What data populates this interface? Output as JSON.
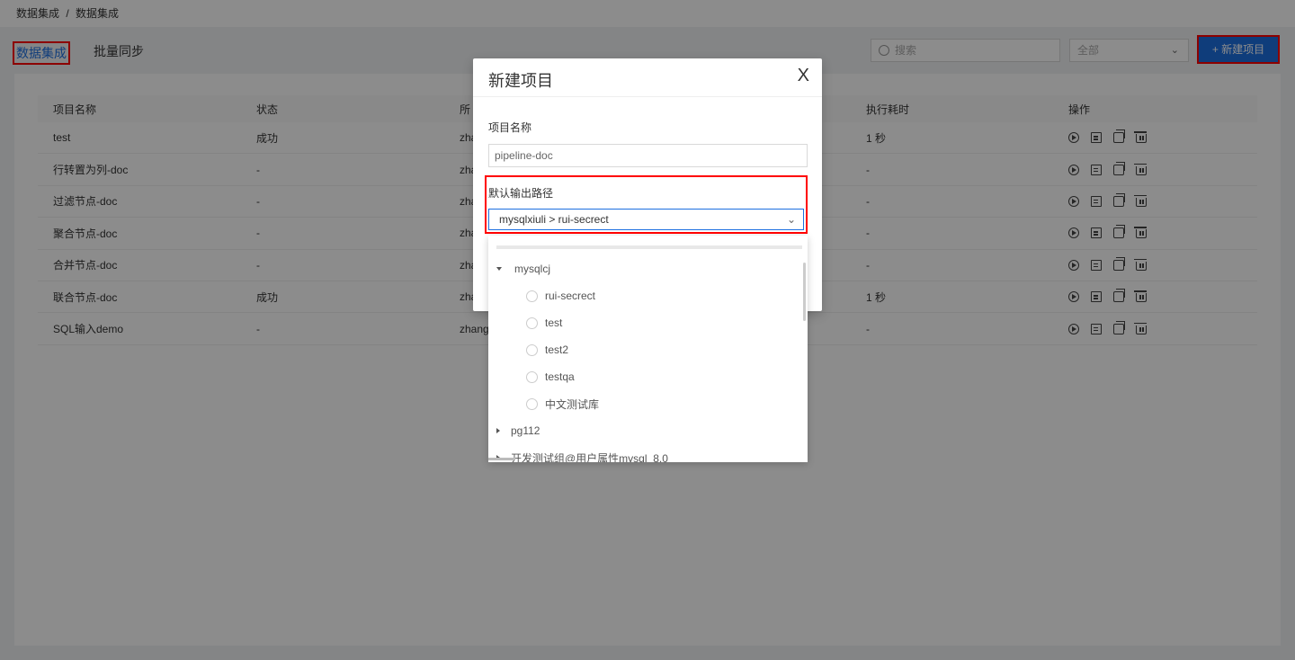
{
  "breadcrumb": [
    "数据集成",
    "/",
    "数据集成"
  ],
  "tabs": [
    {
      "label": "数据集成",
      "active": true
    },
    {
      "label": "批量同步",
      "active": false
    }
  ],
  "toolbar": {
    "search_placeholder": "搜索",
    "filter_value": "全部",
    "new_button_label": "+ 新建项目"
  },
  "table": {
    "headers": [
      "项目名称",
      "状态",
      "所",
      "",
      "执行耗时",
      "操作"
    ],
    "rows": [
      {
        "name": "test",
        "status": "成功",
        "owner": "zha",
        "duration": "1 秒"
      },
      {
        "name": "行转置为列-doc",
        "status": "-",
        "owner": "zha",
        "duration": "-"
      },
      {
        "name": "过滤节点-doc",
        "status": "-",
        "owner": "zha",
        "duration": "-"
      },
      {
        "name": "聚合节点-doc",
        "status": "-",
        "owner": "zha",
        "duration": "-"
      },
      {
        "name": "合并节点-doc",
        "status": "-",
        "owner": "zha",
        "duration": "-"
      },
      {
        "name": "联合节点-doc",
        "status": "成功",
        "owner": "zha",
        "duration": "1 秒"
      },
      {
        "name": "SQL输入demo",
        "status": "-",
        "owner": "zhang",
        "duration": "-"
      }
    ]
  },
  "modal": {
    "title": "新建项目",
    "close_glyph": "X",
    "name_label": "项目名称",
    "name_value": "pipeline-doc",
    "path_label": "默认输出路径",
    "path_value": "mysqlxiuli > rui-secrect"
  },
  "tree": {
    "groups": [
      {
        "label": "mysqlcj",
        "expanded": true,
        "children": [
          "rui-secrect",
          "test",
          "test2",
          "testqa",
          "中文测试库"
        ]
      },
      {
        "label": "pg112",
        "expanded": false,
        "children": []
      },
      {
        "label": "开发测试组@用户属性mysql_8.0",
        "expanded": false,
        "children": []
      }
    ]
  },
  "colors": {
    "accent": "#1d6fe0",
    "highlight_border": "#ff0000",
    "overlay": "rgba(0,0,0,0.45)"
  },
  "icons": [
    "search-icon",
    "chevron-down-icon",
    "run-icon",
    "edit-icon",
    "copy-icon",
    "delete-icon",
    "close-icon"
  ]
}
